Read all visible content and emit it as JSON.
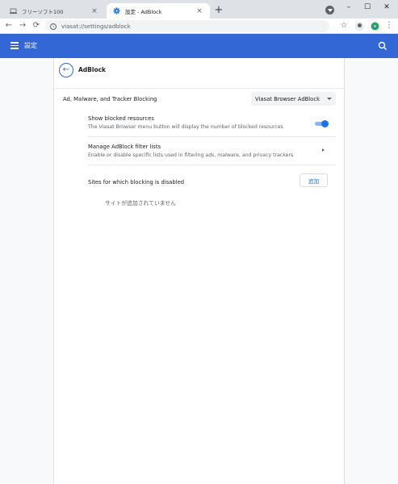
{
  "tabs": [
    {
      "title": "フリーソフト100",
      "icon": "laptop-icon",
      "active": false
    },
    {
      "title": "設定 - AdBlock",
      "icon": "gear-icon",
      "active": true
    }
  ],
  "toolbar": {
    "url": "viasat://settings/adblock"
  },
  "header": {
    "title": "設定"
  },
  "page": {
    "title": "AdBlock"
  },
  "blocking": {
    "label": "Ad, Malware, and Tracker Blocking",
    "selected": "Viasat Browser AdBlock"
  },
  "show_blocked": {
    "title": "Show blocked resources",
    "subtitle": "The Viasat Browser menu button will display the number of blocked resources",
    "enabled": true
  },
  "filter_lists": {
    "title": "Manage AdBlock filter lists",
    "subtitle": "Enable or disable specific lists used in filtering ads, malware, and privacy trackers"
  },
  "exceptions": {
    "title": "Sites for which blocking is disabled",
    "add_label": "追加",
    "empty_message": "サイトが追加されていません"
  },
  "colors": {
    "accent": "#3367d6",
    "toggle_on": "#1a73e8"
  }
}
